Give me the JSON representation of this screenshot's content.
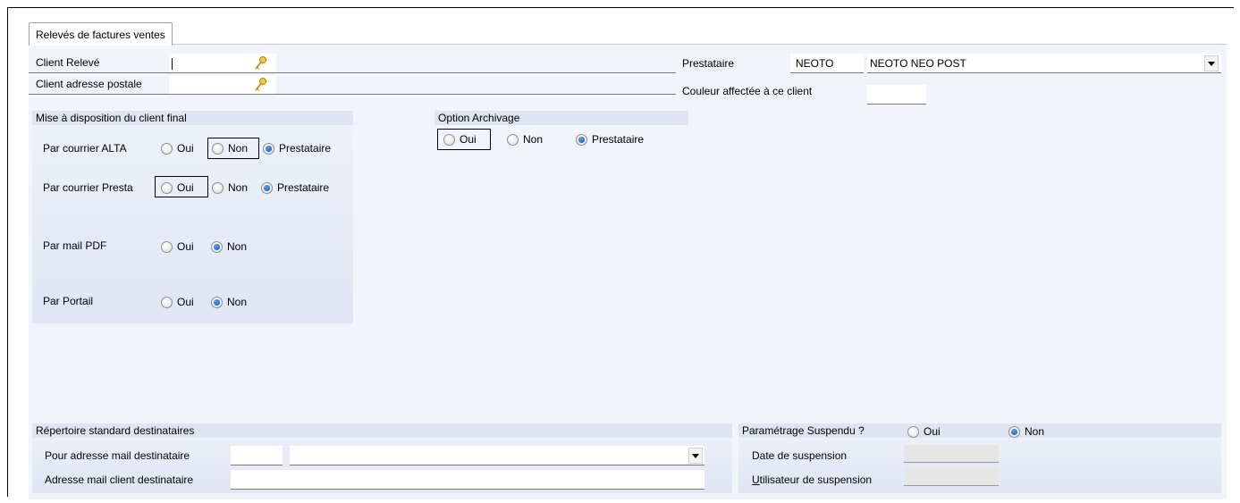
{
  "tab": {
    "label": "Relevés de factures ventes"
  },
  "header": {
    "client_releve_label": "Client Relevé",
    "client_adresse_label": "Client adresse postale",
    "prestataire_label": "Prestataire",
    "prestataire_code": "NEOTO",
    "prestataire_name": "NEOTO NEO POST",
    "couleur_label": "Couleur affectée à ce client"
  },
  "mise_a_disposition": {
    "title": "Mise à disposition du client final",
    "rows": [
      {
        "label": "Par courrier ALTA",
        "options": [
          "Oui",
          "Non",
          "Prestataire"
        ],
        "selected": "Prestataire"
      },
      {
        "label": "Par courrier Presta",
        "options": [
          "Oui",
          "Non",
          "Prestataire"
        ],
        "selected": "Prestataire"
      },
      {
        "label": "Par mail PDF",
        "options": [
          "Oui",
          "Non"
        ],
        "selected": "Non"
      },
      {
        "label": "Par Portail",
        "options": [
          "Oui",
          "Non"
        ],
        "selected": "Non"
      }
    ]
  },
  "option_archivage": {
    "title": "Option Archivage",
    "options": [
      "Oui",
      "Non",
      "Prestataire"
    ],
    "selected": "Prestataire"
  },
  "repertoire": {
    "title": "Répertoire standard destinataires",
    "pour_adresse_label": "Pour adresse mail destinataire",
    "adresse_client_label": "Adresse mail client destinataire"
  },
  "suspension": {
    "title": "Paramétrage Suspendu ?",
    "options": [
      "Oui",
      "Non"
    ],
    "selected": "Non",
    "date_label": "Date de suspension",
    "user_label_prefix": "U",
    "user_label_rest": "tilisateur de suspension"
  },
  "icons": {
    "key": "key-icon",
    "dropdown": "chevron-down-icon",
    "radio": "radio-icon"
  },
  "colors": {
    "panel_bg": "#f1f4fa",
    "section_head": "#dfe4f2",
    "radio_selected": "#0f4fa3"
  }
}
